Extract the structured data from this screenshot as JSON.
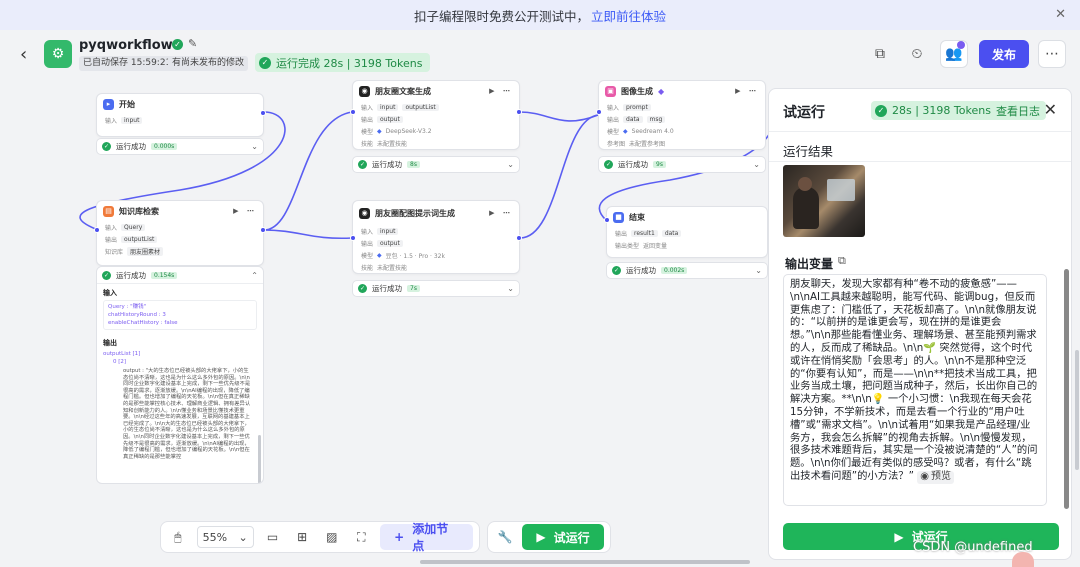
{
  "banner": {
    "text": "扣子编程限时免费公开测试中，",
    "link": "立即前往体验"
  },
  "header": {
    "title": "pyqworkflow",
    "autosave": "已自动保存 15:59:21",
    "unpublished": "有尚未发布的修改",
    "run_status": "运行完成 28s | 3198 Tokens",
    "publish": "发布",
    "icons": [
      "back-arrow",
      "verified",
      "edit",
      "copy",
      "history",
      "collaborators",
      "more"
    ]
  },
  "nodes": {
    "start": {
      "title": "开始",
      "input_label": "输入",
      "input": "input",
      "run": "运行成功",
      "time": "0.000s"
    },
    "kb": {
      "title": "知识库检索",
      "in_label": "输入",
      "in": "Query",
      "out_label": "输出",
      "out": "outputList",
      "kb_label": "知识库",
      "kb": "朋友圈素材",
      "run": "运行成功",
      "time": "0.154s"
    },
    "copywrite": {
      "title": "朋友圈文案生成",
      "in_label": "输入",
      "in1": "input",
      "in2": "outputList",
      "out_label": "输出",
      "out": "output",
      "model_label": "模型",
      "model": "DeepSeek-V3.2",
      "skill_label": "技能",
      "skill": "未配置技能",
      "run": "运行成功",
      "time": "8s"
    },
    "prompt": {
      "title": "朋友圈配图提示词生成",
      "in_label": "输入",
      "in": "input",
      "out_label": "输出",
      "out": "output",
      "model_label": "模型",
      "model": "豆包 · 1.5 · Pro · 32k",
      "skill_label": "技能",
      "skill": "未配置技能",
      "run": "运行成功",
      "time": "7s"
    },
    "image": {
      "title": "图像生成",
      "in_label": "输入",
      "in": "prompt",
      "out_label": "输出",
      "out1": "data",
      "out2": "msg",
      "model_label": "模型",
      "model": "Seedream 4.0",
      "ref_label": "参考图",
      "ref": "未配置参考图",
      "run": "运行成功",
      "time": "9s"
    },
    "end": {
      "title": "结束",
      "out_label": "输出",
      "out1": "result1",
      "out2": "data",
      "type_label": "输出类型",
      "type": "返回变量",
      "run": "运行成功",
      "time": "0.002s"
    }
  },
  "kb_detail": {
    "input_title": "输入",
    "input_lines": [
      "Query : \"赚钱\"",
      "chatHistoryRound : 3",
      "enableChatHistory : false"
    ],
    "output_title": "输出",
    "output_tree": [
      "outputList [1]",
      "0 [2]"
    ],
    "output_text": "output : \"大的生态位已经被头部的大佬拿下，小的生态位尚不清晰，这也是为什么这么多外包的原因。\\n\\n同时企业数字化建设基本上完成，剩下一些优先级不是很高的需求，逐渐放缓。\\n\\nAI编程的出现，降低了编程门槛。但也增加了编程的天花板。\\n\\n但在真正稀缺的是那些能掌控核心技术、理解商业逻辑、拥有差异认知和创新能力的人。\\n\\n懂业务和场景比懂技术更重要。\\n\\n经过这些年的高速发展，互联网的基建基本上已经完成了。\\n\\n大的生态位已经被头部的大佬拿下，小的生态位尚不清晰，这也是为什么这么多外包的原因。\\n\\n同时企业数字化建设基本上完成，剩下一些优先级不是很高的需求，逐渐放缓。\\n\\nAI编程的出现，降低了编程门槛，但也增加了编程的天花板。\\n\\n但在真正稀缺的是那些能掌控"
  },
  "toolbar": {
    "zoom": "55%",
    "add_node": "添加节点",
    "test_run": "试运行"
  },
  "panel": {
    "title": "试运行",
    "status": "28s | 3198 Tokens",
    "view_log": "查看日志",
    "result_title": "运行结果",
    "output_var": "输出变量",
    "output_text": "朋友聊天，发现大家都有种“卷不动的疲惫感”——\\n\\nAI工具越来越聪明，能写代码、能调bug，但反而更焦虑了：门槛低了，天花板却高了。\\n\\n就像朋友说的：“以前拼的是谁更会写，现在拼的是谁更会想。”\\n\\n那些能看懂业务、理解场景、甚至能预判需求的人，反而成了稀缺品。\\n\\n🌱 突然觉得，这个时代或许在悄悄奖励「会思考」的人。\\n\\n不是那种空泛的“你要有认知”，而是——\\n\\n**把技术当成工具，把业务当成土壤，把问题当成种子，然后，长出你自己的解决方案。**\\n\\n💡 一个小习惯：\\n我现在每天会花15分钟，不学新技术，而是去看一个行业的“用户吐槽”或“需求文档”。\\n\\n试着用“如果我是产品经理/业务方，我会怎么拆解”的视角去拆解。\\n\\n慢慢发现，很多技术难题背后，其实是一个没被说清楚的“人”的问题。\\n\\n你们最近有类似的感受吗？或者，有什么“跳出技术看问题”的小方法？”",
    "preview": "预览",
    "run_button": "试运行"
  },
  "watermark": "CSDN @undefined",
  "colors": {
    "accent": "#4b4ff0",
    "success": "#1fb55a",
    "success_bg": "#d6f2df",
    "banner_bg": "#eaedfb"
  }
}
